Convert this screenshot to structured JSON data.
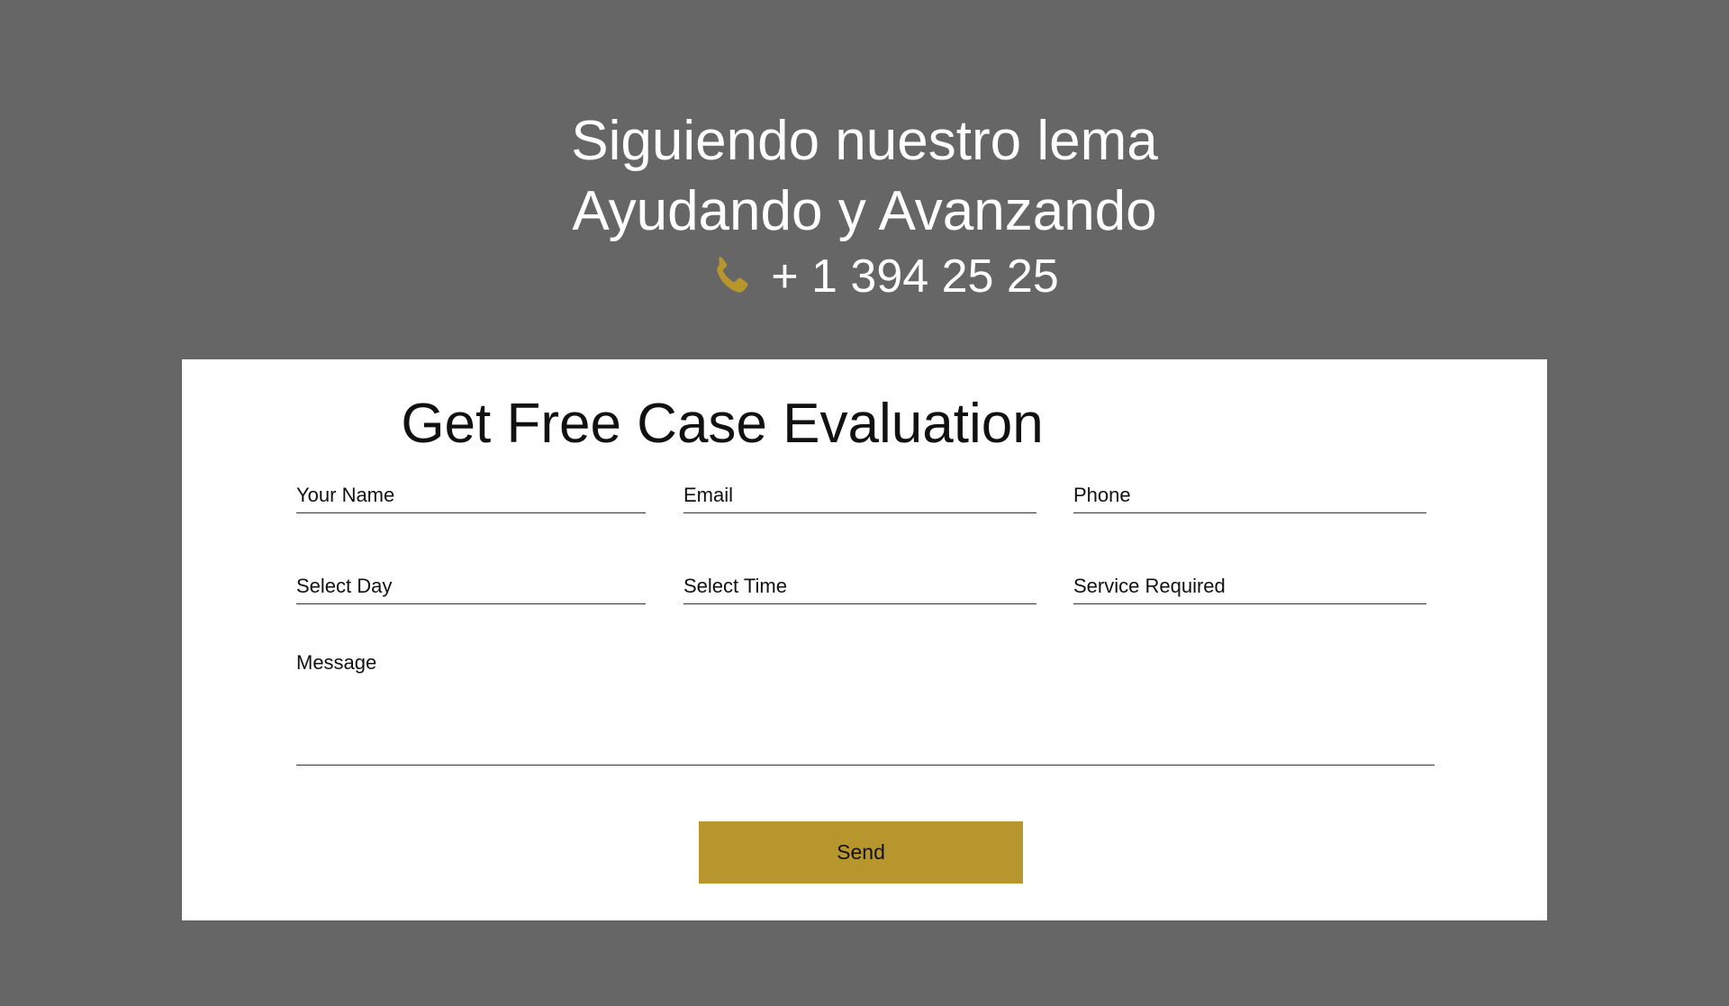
{
  "hero": {
    "line1": "Siguiendo nuestro lema",
    "line2": "Ayudando y Avanzando",
    "phone": "+ 1 394 25 25",
    "phone_icon": "phone-icon"
  },
  "form": {
    "title": "Get Free Case Evaluation",
    "fields": {
      "name": "Your Name",
      "email": "Email",
      "phone": "Phone",
      "day": "Select Day",
      "time": "Select Time",
      "service": "Service Required",
      "message": "Message"
    },
    "send_label": "Send"
  },
  "colors": {
    "background": "#666666",
    "card": "#ffffff",
    "accent": "#b8962e"
  }
}
